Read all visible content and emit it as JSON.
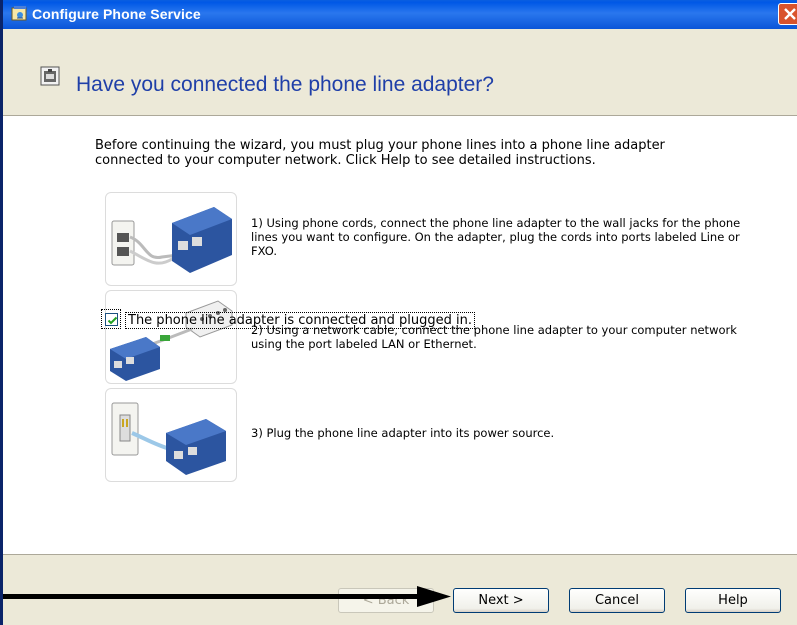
{
  "window": {
    "title": "Configure Phone Service"
  },
  "header": {
    "heading": "Have you connected the phone line adapter?",
    "icon": "phone-adapter-icon"
  },
  "content": {
    "intro": "Before continuing the wizard, you must plug your phone lines into a phone line adapter connected to your computer network. Click Help to see detailed instructions.",
    "steps": [
      {
        "text": "1) Using phone cords, connect the phone line adapter to the wall jacks for the phone lines you want to configure. On the adapter, plug the cords into ports labeled Line or FXO.",
        "image": "wall-jack-to-adapter-image"
      },
      {
        "text": "2) Using a network cable, connect the phone line adapter to your computer network using the port labeled LAN or Ethernet.",
        "image": "network-cable-to-switch-image"
      },
      {
        "text": "3) Plug the phone line adapter into its power source.",
        "image": "power-outlet-image"
      }
    ],
    "checkbox": {
      "label": "The phone line adapter is connected and plugged in.",
      "checked": true
    }
  },
  "buttons": {
    "back": "< Back",
    "next": "Next >",
    "cancel": "Cancel",
    "help": "Help"
  },
  "colors": {
    "titlebar": "#0058e6",
    "heading": "#1f3fa8",
    "dialog_bg": "#ece9d8"
  }
}
